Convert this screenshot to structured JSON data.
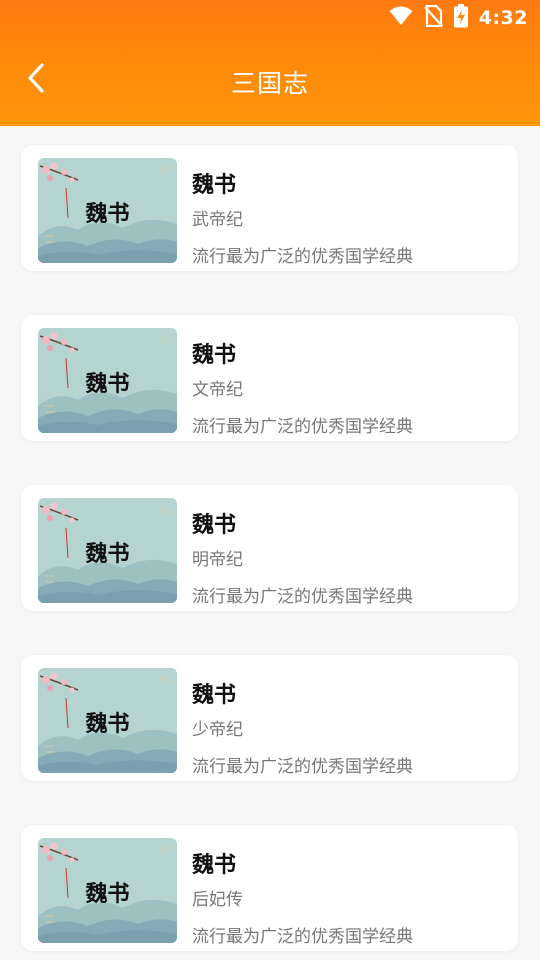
{
  "status_bar": {
    "time": "4:32",
    "icons": [
      "wifi-icon",
      "no-sim-icon",
      "battery-charging-icon"
    ]
  },
  "header": {
    "title": "三国志",
    "back_icon": "chevron-left-icon"
  },
  "colors": {
    "header_gradient_start": "#ff7a10",
    "header_gradient_end": "#ff960a",
    "thumb_background": "#b5d3cf"
  },
  "books": [
    {
      "thumb_label": "魏书",
      "title": "魏书",
      "subtitle": "武帝纪",
      "description": "流行最为广泛的优秀国学经典"
    },
    {
      "thumb_label": "魏书",
      "title": "魏书",
      "subtitle": "文帝纪",
      "description": "流行最为广泛的优秀国学经典"
    },
    {
      "thumb_label": "魏书",
      "title": "魏书",
      "subtitle": "明帝纪",
      "description": "流行最为广泛的优秀国学经典"
    },
    {
      "thumb_label": "魏书",
      "title": "魏书",
      "subtitle": "少帝纪",
      "description": "流行最为广泛的优秀国学经典"
    },
    {
      "thumb_label": "魏书",
      "title": "魏书",
      "subtitle": "后妃传",
      "description": "流行最为广泛的优秀国学经典"
    }
  ]
}
